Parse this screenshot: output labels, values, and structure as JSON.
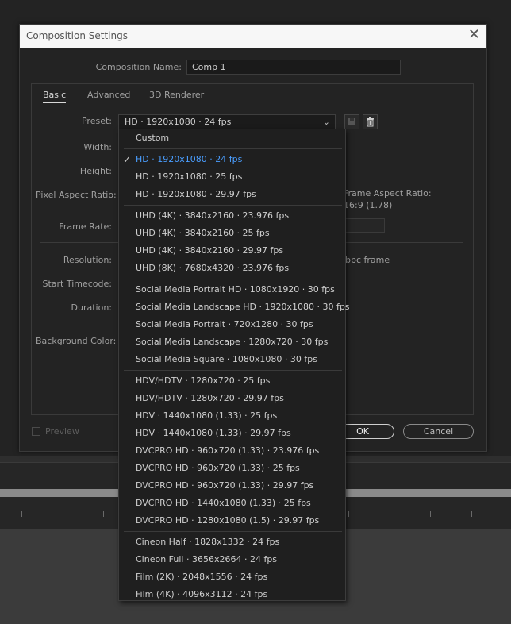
{
  "dialog": {
    "title": "Composition Settings",
    "close_glyph": "✕",
    "comp_name_label": "Composition Name:",
    "comp_name_value": "Comp 1",
    "tabs": [
      "Basic",
      "Advanced",
      "3D Renderer"
    ],
    "active_tab": "Basic",
    "preset_label": "Preset:",
    "preset_value": "HD  ·  1920x1080 · 24 fps",
    "fields": {
      "width": "Width:",
      "height": "Height:",
      "par": "Pixel Aspect Ratio:",
      "frame_rate": "Frame Rate:",
      "resolution": "Resolution:",
      "start_timecode": "Start Timecode:",
      "duration": "Duration:",
      "background_color": "Background Color:"
    },
    "frame_aspect_label": "Frame Aspect Ratio:",
    "frame_aspect_value": "16:9 (1.78)",
    "resolution_suffix": "bpc frame",
    "preview_label": "Preview",
    "ok_label": "OK",
    "cancel_label": "Cancel"
  },
  "preset_menu": {
    "custom": "Custom",
    "groups": [
      [
        "HD  ·  1920x1080 · 24 fps",
        "HD  ·  1920x1080 · 25 fps",
        "HD  ·  1920x1080 · 29.97 fps"
      ],
      [
        "UHD (4K)  ·  3840x2160 · 23.976 fps",
        "UHD (4K)  ·  3840x2160 · 25 fps",
        "UHD (4K)  ·  3840x2160 · 29.97 fps",
        "UHD (8K)  ·  7680x4320 · 23.976 fps"
      ],
      [
        "Social Media Portrait HD  ·  1080x1920 · 30 fps",
        "Social Media Landscape HD  ·  1920x1080 · 30 fps",
        "Social Media Portrait  ·  720x1280 · 30 fps",
        "Social Media Landscape  ·  1280x720 · 30 fps",
        "Social Media Square  ·  1080x1080 · 30 fps"
      ],
      [
        "HDV/HDTV  ·  1280x720 · 25 fps",
        "HDV/HDTV  ·  1280x720 · 29.97 fps",
        "HDV  ·  1440x1080 (1.33) · 25 fps",
        "HDV  ·  1440x1080 (1.33) · 29.97 fps",
        "DVCPRO HD  ·  960x720 (1.33) · 23.976 fps",
        "DVCPRO HD  ·  960x720 (1.33) · 25 fps",
        "DVCPRO HD  ·  960x720 (1.33) · 29.97 fps",
        "DVCPRO HD  ·  1440x1080 (1.33) · 25 fps",
        "DVCPRO HD  ·  1280x1080 (1.5) · 29.97 fps"
      ],
      [
        "Cineon Half  ·  1828x1332 · 24 fps",
        "Cineon Full  ·  3656x2664 · 24 fps",
        "Film (2K)  ·  2048x1556 · 24 fps",
        "Film (4K)  ·  4096x3112 · 24 fps"
      ]
    ],
    "selected": "HD  ·  1920x1080 · 24 fps",
    "check_glyph": "✓",
    "accent_color": "#4a9eff"
  }
}
